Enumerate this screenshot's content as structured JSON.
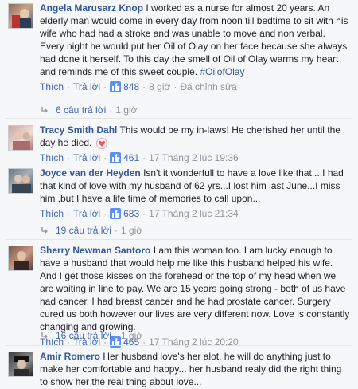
{
  "comments": [
    {
      "author": "Angela Marusarz Knop",
      "text": "I worked as a nurse for almost 20 years. An elderly man would come in every day from noon till bedtime to sit with his wife who had had a stroke and was unable to move and non verbal. Every night he would put her Oil of Olay on her face because she always had done it herself. To this day the smell of Oil of Olay warms my heart and reminds me of this sweet couple.",
      "hashtag": "#OilofOlay",
      "like_label": "Thích",
      "reply_label": "Trả lời",
      "likes": "848",
      "time": "8 giờ",
      "edited": "Đã chỉnh sửa",
      "replies": "6 câu trả lời",
      "replies_time": "1 giờ"
    },
    {
      "author": "Tracy Smith Dahl",
      "text": "This would be my in-laws! He cherished her until the day he died.",
      "like_label": "Thích",
      "reply_label": "Trả lời",
      "likes": "461",
      "time": "17 Tháng 2 lúc 19:36"
    },
    {
      "author": "Joyce van der Heyden",
      "text": "Isn't it wonderfull to have a love like that....I had that kind of love with my husband of 62 yrs...I lost him last June...I miss him ,but I have a life time of memories to call upon...",
      "like_label": "Thích",
      "reply_label": "Trả lời",
      "likes": "683",
      "time": "17 Tháng 2 lúc 21:34",
      "replies": "19 câu trả lời",
      "replies_time": "1 giờ"
    },
    {
      "author": "Sherry Newman Santoro",
      "text": "I am this woman too. I am lucky enough to have a husband that would help me like this husband helped his wife. And I get those kisses on the forehead or the top of my head when we are waiting in line to pay. We are 15 years going strong - both of us have had cancer. I had breast cancer and he had prostate cancer. Surgery cured us both however our lives are very different now. Love is constantly changing and growing.",
      "like_label": "Thích",
      "reply_label": "Trả lời",
      "likes": "465",
      "time": "17 Tháng 2 lúc 20:20",
      "replies": "16 câu trả lời",
      "replies_time": "1 giờ"
    },
    {
      "author": "Amir Romero",
      "text": "Her husband love's her alot, he will do anything just to make her comfortable and happy... her husband realy did the right thing to show her the real thing about love..."
    }
  ],
  "colors": {
    "link": "#365899",
    "action": "#4267b2",
    "meta": "#90949c",
    "like_badge": "#5890ff"
  }
}
